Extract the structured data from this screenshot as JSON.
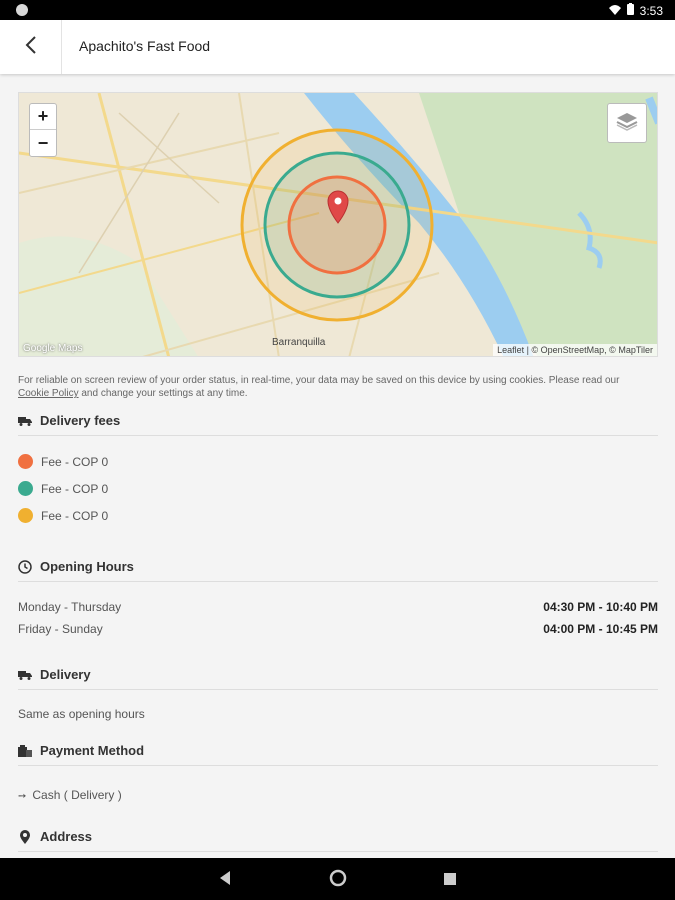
{
  "status": {
    "time": "3:53"
  },
  "header": {
    "title": "Apachito's Fast Food"
  },
  "map": {
    "zoom_in": "+",
    "zoom_out": "−",
    "credit": "Google Maps",
    "attribution": "Leaflet | © OpenStreetMap, © MapTiler",
    "city_label": "Barranquilla",
    "zone_colors": [
      "#f07040",
      "#3aaa8f",
      "#f0b030"
    ]
  },
  "cookie": {
    "text": "For reliable on screen review of your order status, in real-time, your data may be saved on this device by using cookies. Please read our",
    "link": "Cookie Policy",
    "text_after": "and change your settings at any time."
  },
  "delivery_fees": {
    "heading": "Delivery fees",
    "items": [
      {
        "label": "Fee - COP 0",
        "color": "#f07040"
      },
      {
        "label": "Fee - COP 0",
        "color": "#3aaa8f"
      },
      {
        "label": "Fee - COP 0",
        "color": "#f0b030"
      }
    ]
  },
  "opening_hours": {
    "heading": "Opening Hours",
    "rows": [
      {
        "days": "Monday - Thursday",
        "time": "04:30 PM - 10:40 PM"
      },
      {
        "days": "Friday - Sunday",
        "time": "04:00 PM - 10:45 PM"
      }
    ]
  },
  "delivery": {
    "heading": "Delivery",
    "text": "Same as opening hours"
  },
  "payment": {
    "heading": "Payment Method",
    "item": "Cash ( Delivery )"
  },
  "address": {
    "heading": "Address"
  }
}
